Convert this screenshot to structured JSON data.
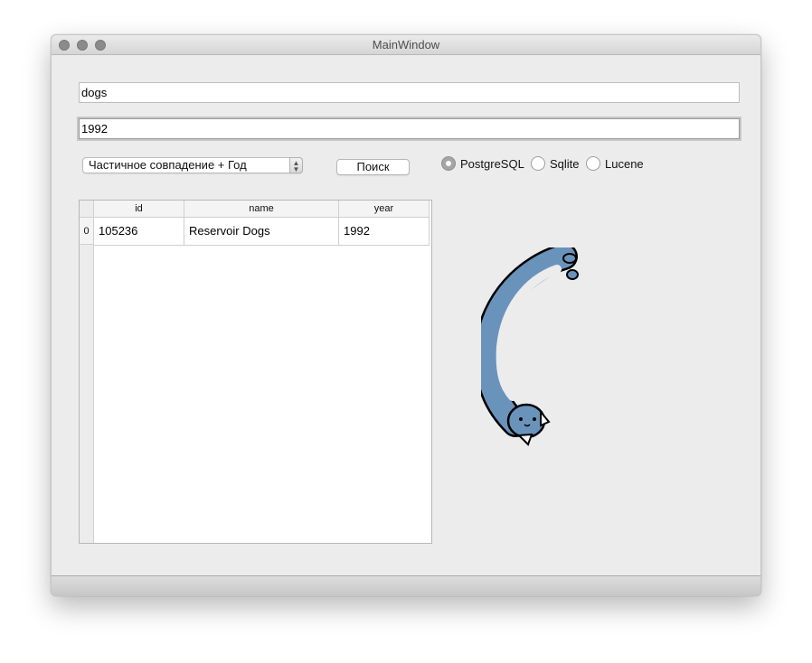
{
  "window": {
    "title": "MainWindow"
  },
  "search": {
    "query": "dogs",
    "year": "1992"
  },
  "mode": {
    "selected": "Частичное совпадение + Год"
  },
  "search_button": {
    "label": "Поиск"
  },
  "radios": [
    {
      "label": "PostgreSQL",
      "checked": true
    },
    {
      "label": "Sqlite",
      "checked": false
    },
    {
      "label": "Lucene",
      "checked": false
    }
  ],
  "table": {
    "columns": [
      "id",
      "name",
      "year"
    ],
    "rows": [
      {
        "index": "0",
        "id": "105236",
        "name": "Reservoir Dogs",
        "year": "1992"
      }
    ]
  },
  "icons": {
    "combo": "updown-arrows-icon",
    "mascot": "curled-cat-icon"
  },
  "colors": {
    "cat_body": "#6a93bc",
    "radio_checked": "#a5a5a5"
  }
}
